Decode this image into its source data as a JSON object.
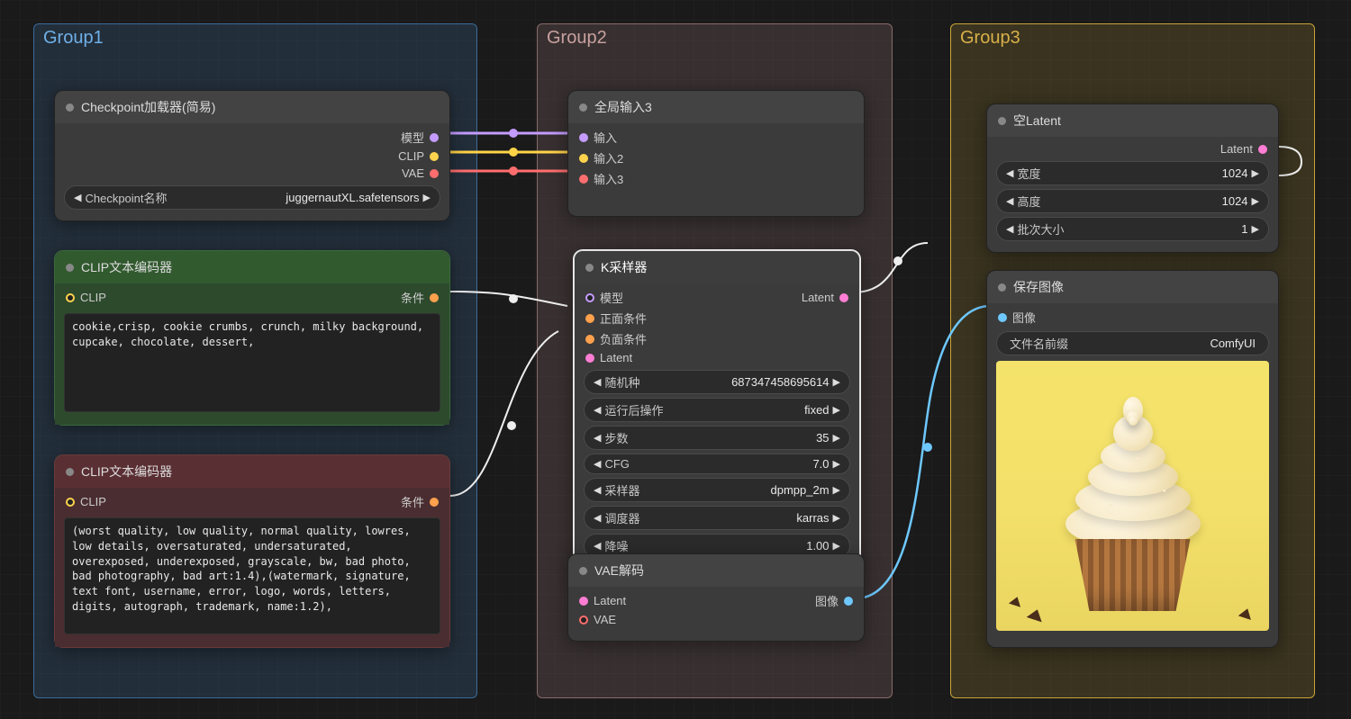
{
  "groups": {
    "g1": {
      "title": "Group1",
      "color": "#3a6a9a"
    },
    "g2": {
      "title": "Group2",
      "color": "#8a6a6a"
    },
    "g3": {
      "title": "Group3",
      "color": "#c9a437"
    }
  },
  "checkpoint_loader": {
    "title": "Checkpoint加载器(简易)",
    "outputs": {
      "model": "模型",
      "clip": "CLIP",
      "vae": "VAE"
    },
    "param_label": "Checkpoint名称",
    "param_value": "juggernautXL.safetensors"
  },
  "clip_pos": {
    "title": "CLIP文本编码器",
    "input": "CLIP",
    "output": "条件",
    "text": "cookie,crisp, cookie crumbs, crunch, milky background, cupcake, chocolate, dessert,"
  },
  "clip_neg": {
    "title": "CLIP文本编码器",
    "input": "CLIP",
    "output": "条件",
    "text": "(worst quality, low quality, normal quality, lowres, low details, oversaturated, undersaturated, overexposed, underexposed, grayscale, bw, bad photo, bad photography, bad art:1.4),(watermark, signature, text font, username, error, logo, words, letters, digits, autograph, trademark, name:1.2),"
  },
  "reroute": {
    "title": "全局输入3",
    "labels": {
      "in1": "输入",
      "in2": "输入2",
      "in3": "输入3"
    }
  },
  "ksampler": {
    "title": "K采样器",
    "inputs": {
      "model": "模型",
      "pos": "正面条件",
      "neg": "负面条件",
      "latent": "Latent"
    },
    "output": "Latent",
    "params": [
      {
        "label": "随机种",
        "value": "687347458695614"
      },
      {
        "label": "运行后操作",
        "value": "fixed"
      },
      {
        "label": "步数",
        "value": "35"
      },
      {
        "label": "CFG",
        "value": "7.0"
      },
      {
        "label": "采样器",
        "value": "dpmpp_2m"
      },
      {
        "label": "调度器",
        "value": "karras"
      },
      {
        "label": "降噪",
        "value": "1.00"
      }
    ]
  },
  "vae_decode": {
    "title": "VAE解码",
    "inputs": {
      "latent": "Latent",
      "vae": "VAE"
    },
    "output": "图像"
  },
  "empty_latent": {
    "title": "空Latent",
    "output": "Latent",
    "params": [
      {
        "label": "宽度",
        "value": "1024"
      },
      {
        "label": "高度",
        "value": "1024"
      },
      {
        "label": "批次大小",
        "value": "1"
      }
    ]
  },
  "save_image": {
    "title": "保存图像",
    "input": "图像",
    "param_label": "文件名前缀",
    "param_value": "ComfyUI"
  }
}
